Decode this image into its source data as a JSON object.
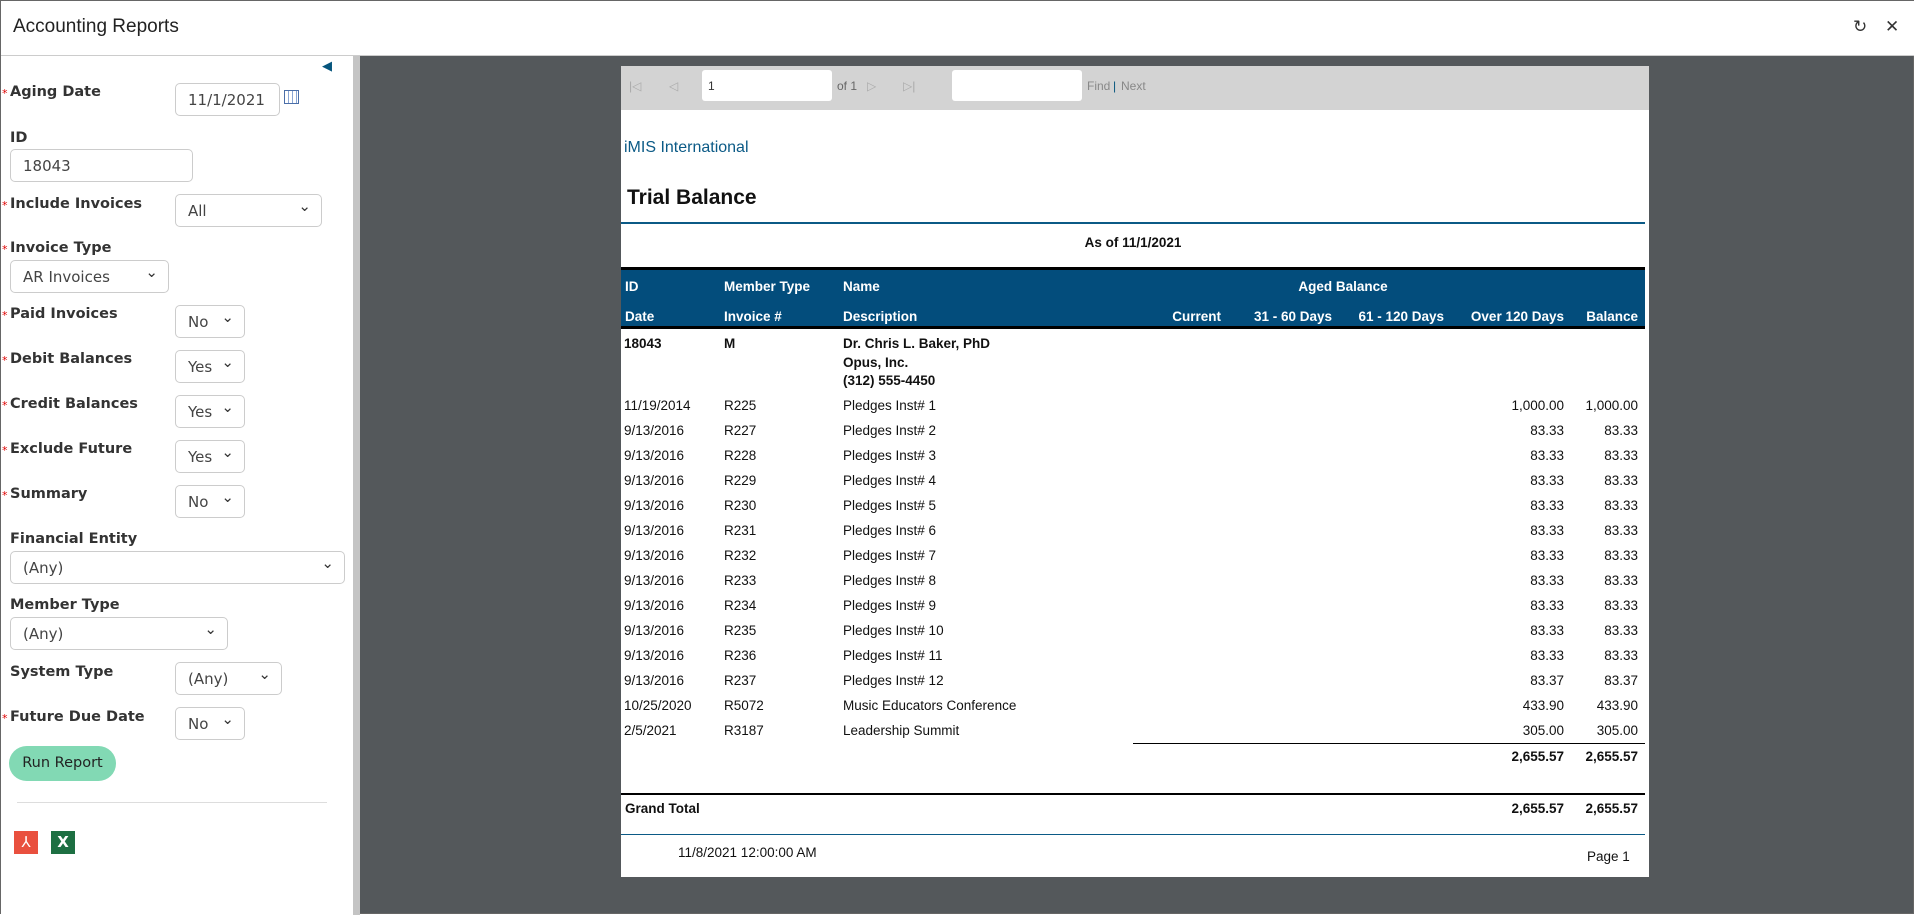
{
  "window": {
    "title": "Accounting Reports",
    "refresh_icon": "refresh-icon",
    "close_icon": "close-icon"
  },
  "params": {
    "aging_date": {
      "label": "Aging Date",
      "value": "11/1/2021"
    },
    "id": {
      "label": "ID",
      "value": "18043"
    },
    "include_invoices": {
      "label": "Include Invoices",
      "value": "All"
    },
    "invoice_type": {
      "label": "Invoice Type",
      "value": "AR Invoices"
    },
    "paid_invoices": {
      "label": "Paid Invoices",
      "value": "No"
    },
    "debit_balances": {
      "label": "Debit Balances",
      "value": "Yes"
    },
    "credit_balances": {
      "label": "Credit Balances",
      "value": "Yes"
    },
    "exclude_future": {
      "label": "Exclude Future",
      "value": "Yes"
    },
    "summary": {
      "label": "Summary",
      "value": "No"
    },
    "financial_entity": {
      "label": "Financial Entity",
      "value": "(Any)"
    },
    "member_type": {
      "label": "Member Type",
      "value": "(Any)"
    },
    "system_type": {
      "label": "System Type",
      "value": "(Any)"
    },
    "future_due_date": {
      "label": "Future Due Date",
      "value": "No"
    },
    "run_label": "Run Report"
  },
  "viewer": {
    "page": "1",
    "of": "of 1",
    "find": "Find",
    "sep": "|",
    "next": "Next"
  },
  "report": {
    "company": "iMIS International",
    "title": "Trial Balance",
    "as_of": "As of 11/1/2021",
    "headers": {
      "id": "ID",
      "member_type": "Member Type",
      "name": "Name",
      "aged": "Aged Balance",
      "date": "Date",
      "invoice": "Invoice #",
      "description": "Description",
      "current": "Current",
      "d31": "31 - 60 Days",
      "d61": "61 - 120 Days",
      "over120": "Over 120 Days",
      "balance": "Balance"
    },
    "member": {
      "id": "18043",
      "type": "M",
      "name": "Dr. Chris L. Baker, PhD",
      "company": "Opus, Inc.",
      "phone": "(312) 555-4450"
    },
    "rows": [
      [
        "11/19/2014",
        "R225",
        "Pledges Inst# 1",
        "1,000.00",
        "1,000.00"
      ],
      [
        "9/13/2016",
        "R227",
        "Pledges Inst# 2",
        "83.33",
        "83.33"
      ],
      [
        "9/13/2016",
        "R228",
        "Pledges Inst# 3",
        "83.33",
        "83.33"
      ],
      [
        "9/13/2016",
        "R229",
        "Pledges Inst# 4",
        "83.33",
        "83.33"
      ],
      [
        "9/13/2016",
        "R230",
        "Pledges Inst# 5",
        "83.33",
        "83.33"
      ],
      [
        "9/13/2016",
        "R231",
        "Pledges Inst# 6",
        "83.33",
        "83.33"
      ],
      [
        "9/13/2016",
        "R232",
        "Pledges Inst# 7",
        "83.33",
        "83.33"
      ],
      [
        "9/13/2016",
        "R233",
        "Pledges Inst# 8",
        "83.33",
        "83.33"
      ],
      [
        "9/13/2016",
        "R234",
        "Pledges Inst# 9",
        "83.33",
        "83.33"
      ],
      [
        "9/13/2016",
        "R235",
        "Pledges Inst# 10",
        "83.33",
        "83.33"
      ],
      [
        "9/13/2016",
        "R236",
        "Pledges Inst# 11",
        "83.33",
        "83.33"
      ],
      [
        "9/13/2016",
        "R237",
        "Pledges Inst# 12",
        "83.37",
        "83.37"
      ],
      [
        "10/25/2020",
        "R5072",
        "Music Educators Conference",
        "433.90",
        "433.90"
      ],
      [
        "2/5/2021",
        "R3187",
        "Leadership Summit",
        "305.00",
        "305.00"
      ]
    ],
    "subtotal": {
      "over120": "2,655.57",
      "balance": "2,655.57"
    },
    "grand_total": {
      "label": "Grand Total",
      "over120": "2,655.57",
      "balance": "2,655.57"
    },
    "footer": {
      "printed": "11/8/2021 12:00:00 AM",
      "page": "Page 1"
    }
  },
  "colors": {
    "header_bg": "#034d7c",
    "run_button": "#82d9b4",
    "viewer_bg": "#54585b"
  }
}
